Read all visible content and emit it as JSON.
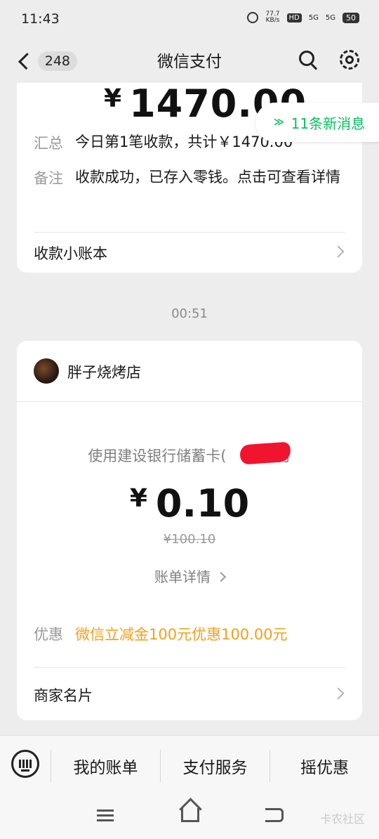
{
  "status_bar": {
    "time": "11:43",
    "net_speed": "77.7",
    "net_unit": "KB/s",
    "hd": "HD",
    "sig1": "5G",
    "sig2": "5G",
    "battery": "50"
  },
  "nav": {
    "unread_count": "248",
    "title": "微信支付"
  },
  "card1": {
    "currency": "¥",
    "amount": "1470.00",
    "summary_label": "汇总",
    "summary_value": "今日第1笔收款，共计￥1470.00",
    "note_label": "备注",
    "note_value": "收款成功，已存入零钱。点击可查看详情",
    "ledger_link": "收款小账本"
  },
  "new_messages": {
    "arrows": "≫",
    "label": "11条新消息"
  },
  "timestamp": "00:51",
  "card2": {
    "merchant": "胖子烧烤店",
    "pay_method": "使用建设银行储蓄卡(　　)支付",
    "currency": "¥",
    "amount": "0.10",
    "original_amount": "¥100.10",
    "bill_detail": "账单详情",
    "discount_label": "优惠",
    "discount_value": "微信立减金100元优惠100.00元",
    "merchant_card": "商家名片"
  },
  "bottom_menu": {
    "items": [
      "我的账单",
      "支付服务",
      "摇优惠"
    ]
  },
  "watermark": "卡农社区",
  "colors": {
    "accent_green": "#07c160",
    "discount_orange": "#f2a01a",
    "background": "#ededed"
  },
  "icons": [
    "alarm-icon",
    "back-chevron-icon",
    "search-icon",
    "gear-icon",
    "double-up-arrow-icon",
    "chevron-right-icon",
    "keyboard-icon",
    "menu-icon",
    "home-icon",
    "back-icon"
  ]
}
